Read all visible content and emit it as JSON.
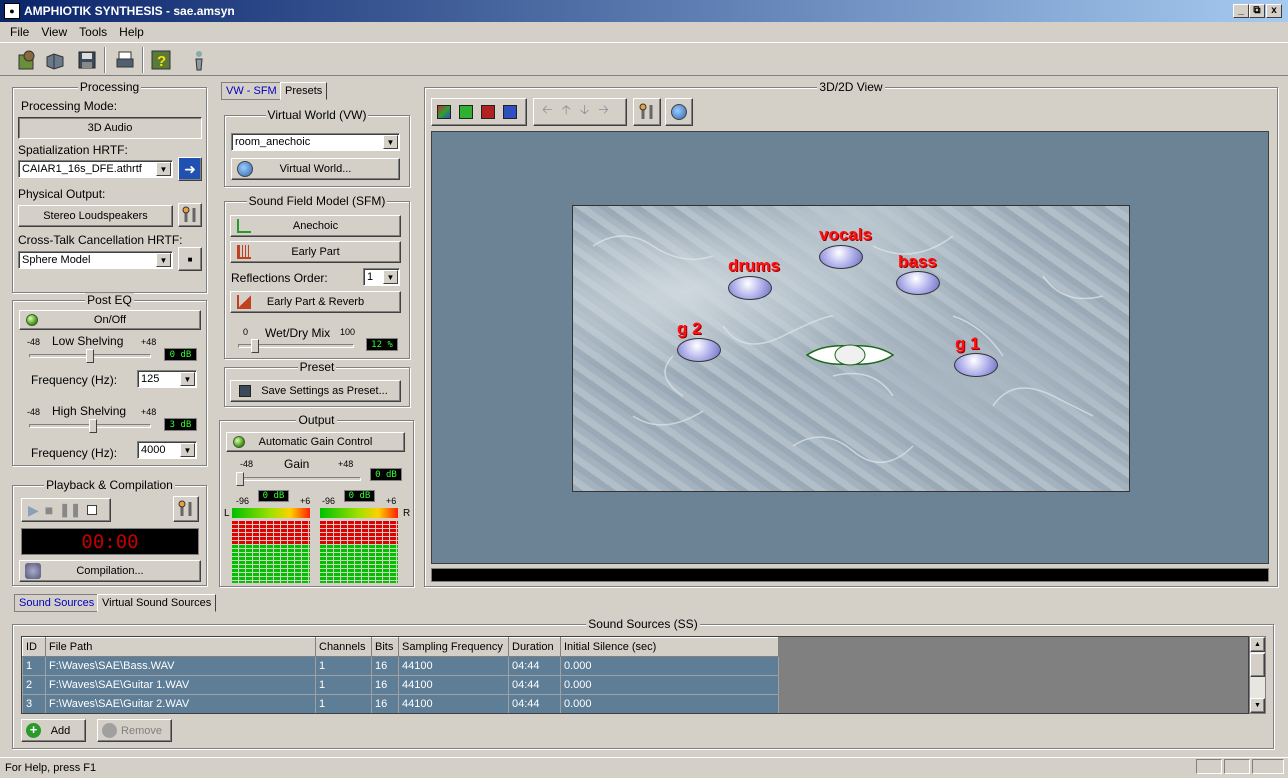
{
  "window": {
    "title": "AMPHIOTIK SYNTHESIS - sae.amsyn",
    "min": "_",
    "restore": "⧉",
    "close": "x"
  },
  "menu": [
    "File",
    "View",
    "Tools",
    "Help"
  ],
  "toolbar": {
    "icons": [
      "new-project-icon",
      "open-icon",
      "save-icon",
      "print-icon",
      "help-icon",
      "info-icon"
    ]
  },
  "processing": {
    "title": "Processing",
    "mode_label": "Processing Mode:",
    "mode_button": "3D Audio",
    "hrtf_label": "Spatialization HRTF:",
    "hrtf_value": "CAIAR1_16s_DFE.athrtf",
    "output_label": "Physical Output:",
    "output_button": "Stereo Loudspeakers",
    "xtalk_label": "Cross-Talk Cancellation HRTF:",
    "xtalk_value": "Sphere Model"
  },
  "post_eq": {
    "title": "Post EQ",
    "onoff": "On/Off",
    "low_label": "Low Shelving",
    "high_label": "High Shelving",
    "min": "-48",
    "max": "+48",
    "low_value": "0 dB",
    "high_value": "3 dB",
    "low_level": 0.5,
    "high_level": 0.53,
    "freq_label": "Frequency (Hz):",
    "low_freq": "125",
    "high_freq": "4000"
  },
  "playback": {
    "title": "Playback & Compilation",
    "time": "00:00",
    "compile_button": "Compilation..."
  },
  "mid_tabs": [
    "VW - SFM",
    "Presets"
  ],
  "virtual_world": {
    "title": "Virtual World (VW)",
    "value": "room_anechoic",
    "button": "Virtual World..."
  },
  "sfm": {
    "title": "Sound Field Model (SFM)",
    "anechoic": "Anechoic",
    "early": "Early Part",
    "refl_label": "Reflections Order:",
    "refl_value": "1",
    "early_reverb": "Early Part & Reverb",
    "mix_min": "0",
    "mix_max": "100",
    "mix_label": "Wet/Dry Mix",
    "mix_value": "12 %",
    "mix_level": 0.12
  },
  "preset": {
    "title": "Preset",
    "button": "Save Settings as Preset..."
  },
  "output": {
    "title": "Output",
    "agc": "Automatic Gain Control",
    "gain_label": "Gain",
    "gain_min": "-48",
    "gain_max": "+48",
    "gain_value": "0 dB",
    "gain_level": 0.0,
    "meter_min": "-96",
    "meter_max": "+6",
    "left_value": "0 dB",
    "right_value": "0 dB",
    "left_label": "L",
    "right_label": "R"
  },
  "view": {
    "title": "3D/2D View",
    "sources": [
      {
        "name": "vocals"
      },
      {
        "name": "drums"
      },
      {
        "name": "bass"
      },
      {
        "name": "g 2"
      },
      {
        "name": "g 1"
      }
    ]
  },
  "bottom_tabs": [
    "Sound Sources",
    "Virtual Sound Sources"
  ],
  "sound_sources": {
    "title": "Sound Sources (SS)",
    "columns": [
      "ID",
      "File Path",
      "Channels",
      "Bits",
      "Sampling Frequency",
      "Duration",
      "Initial Silence (sec)"
    ],
    "rows": [
      [
        "1",
        "F:\\Waves\\SAE\\Bass.WAV",
        "1",
        "16",
        "44100",
        "04:44",
        "0.000"
      ],
      [
        "2",
        "F:\\Waves\\SAE\\Guitar 1.WAV",
        "1",
        "16",
        "44100",
        "04:44",
        "0.000"
      ],
      [
        "3",
        "F:\\Waves\\SAE\\Guitar 2.WAV",
        "1",
        "16",
        "44100",
        "04:44",
        "0.000"
      ]
    ],
    "add": "Add",
    "remove": "Remove"
  },
  "status": "For Help, press F1"
}
